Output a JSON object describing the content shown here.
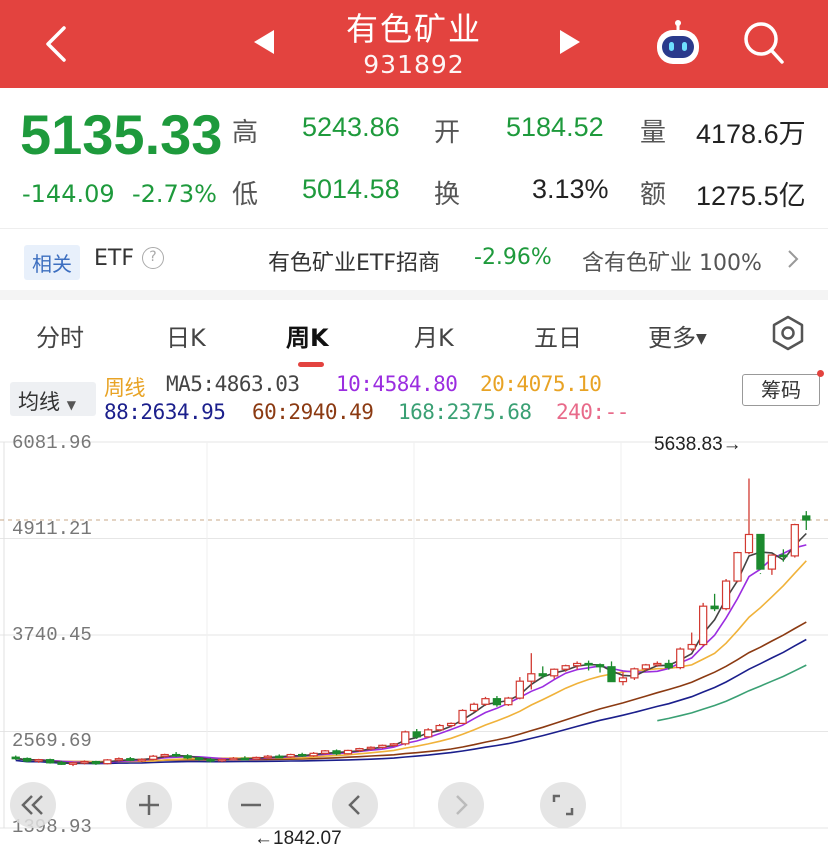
{
  "header": {
    "title": "有色矿业",
    "code": "931892"
  },
  "quote": {
    "price": "5135.33",
    "change": "-144.09",
    "change_pct": "-2.73%",
    "high_label": "高",
    "high": "5243.86",
    "low_label": "低",
    "low": "5014.58",
    "open_label": "开",
    "open": "5184.52",
    "turnover_label": "换",
    "turnover": "3.13%",
    "volume_label": "量",
    "volume": "4178.6万",
    "amount_label": "额",
    "amount": "1275.5亿"
  },
  "etf": {
    "tag": "相关",
    "label": "ETF",
    "name": "有色矿业ETF招商",
    "change_pct": "-2.96%",
    "holding": "含有色矿业 100%"
  },
  "tabs": [
    {
      "label": "分时"
    },
    {
      "label": "日K"
    },
    {
      "label": "周K"
    },
    {
      "label": "月K"
    },
    {
      "label": "五日"
    },
    {
      "label": "更多"
    }
  ],
  "indicators": {
    "selector": "均线",
    "period": "周线",
    "ma5": "MA5:4863.03",
    "ma10": "10:4584.80",
    "ma20": "20:4075.10",
    "ma88": "88:2634.95",
    "ma60": "60:2940.49",
    "ma168": "168:2375.68",
    "ma240": "240:--",
    "chip_button": "筹码"
  },
  "chart_data": {
    "type": "candlestick",
    "y_ticks": [
      "6081.96",
      "4911.21",
      "3740.45",
      "2569.69",
      "1398.93"
    ],
    "ylim": [
      1398.93,
      6081.96
    ],
    "max_label": "5638.83→",
    "min_label": "←1842.07",
    "last_price": 5135.33,
    "colors": {
      "up": "#d23a32",
      "down": "#1c8a2e",
      "ma5": "#444444",
      "ma10": "#9b2de0",
      "ma20": "#f0b23a",
      "ma60": "#8b3a12",
      "ma88": "#1b1f8c",
      "ma168": "#3aa074"
    },
    "candles": [
      [
        2258,
        2278,
        2225,
        2242
      ],
      [
        2242,
        2255,
        2195,
        2210
      ],
      [
        2210,
        2238,
        2190,
        2228
      ],
      [
        2228,
        2240,
        2180,
        2190
      ],
      [
        2190,
        2215,
        2165,
        2172
      ],
      [
        2172,
        2200,
        2150,
        2190
      ],
      [
        2190,
        2220,
        2170,
        2205
      ],
      [
        2205,
        2215,
        2165,
        2180
      ],
      [
        2180,
        2235,
        2170,
        2225
      ],
      [
        2225,
        2255,
        2205,
        2240
      ],
      [
        2240,
        2260,
        2210,
        2220
      ],
      [
        2220,
        2245,
        2200,
        2232
      ],
      [
        2232,
        2285,
        2220,
        2270
      ],
      [
        2270,
        2300,
        2255,
        2290
      ],
      [
        2290,
        2320,
        2260,
        2275
      ],
      [
        2275,
        2295,
        2235,
        2250
      ],
      [
        2250,
        2262,
        2215,
        2230
      ],
      [
        2230,
        2250,
        2195,
        2215
      ],
      [
        2215,
        2240,
        2200,
        2232
      ],
      [
        2232,
        2260,
        2218,
        2245
      ],
      [
        2245,
        2270,
        2228,
        2238
      ],
      [
        2238,
        2266,
        2225,
        2255
      ],
      [
        2255,
        2285,
        2240,
        2270
      ],
      [
        2270,
        2292,
        2252,
        2262
      ],
      [
        2262,
        2300,
        2250,
        2290
      ],
      [
        2290,
        2312,
        2262,
        2275
      ],
      [
        2275,
        2320,
        2262,
        2305
      ],
      [
        2305,
        2345,
        2290,
        2335
      ],
      [
        2335,
        2352,
        2282,
        2300
      ],
      [
        2300,
        2348,
        2292,
        2340
      ],
      [
        2340,
        2372,
        2322,
        2362
      ],
      [
        2362,
        2390,
        2340,
        2378
      ],
      [
        2378,
        2412,
        2362,
        2402
      ],
      [
        2402,
        2430,
        2385,
        2420
      ],
      [
        2420,
        2580,
        2400,
        2565
      ],
      [
        2565,
        2600,
        2480,
        2505
      ],
      [
        2505,
        2610,
        2495,
        2590
      ],
      [
        2590,
        2660,
        2575,
        2642
      ],
      [
        2642,
        2680,
        2620,
        2668
      ],
      [
        2668,
        2840,
        2660,
        2825
      ],
      [
        2825,
        2920,
        2805,
        2900
      ],
      [
        2900,
        2990,
        2880,
        2968
      ],
      [
        2968,
        3000,
        2870,
        2895
      ],
      [
        2895,
        2990,
        2880,
        2975
      ],
      [
        2975,
        3230,
        2960,
        3180
      ],
      [
        3180,
        3520,
        3080,
        3270
      ],
      [
        3270,
        3360,
        3215,
        3245
      ],
      [
        3245,
        3335,
        3210,
        3325
      ],
      [
        3325,
        3380,
        3295,
        3368
      ],
      [
        3368,
        3420,
        3320,
        3395
      ],
      [
        3395,
        3430,
        3310,
        3380
      ],
      [
        3380,
        3395,
        3285,
        3355
      ],
      [
        3355,
        3420,
        3240,
        3175
      ],
      [
        3175,
        3285,
        3130,
        3220
      ],
      [
        3220,
        3345,
        3195,
        3330
      ],
      [
        3330,
        3390,
        3305,
        3378
      ],
      [
        3378,
        3420,
        3355,
        3395
      ],
      [
        3395,
        3440,
        3320,
        3345
      ],
      [
        3345,
        3590,
        3325,
        3570
      ],
      [
        3570,
        3770,
        3550,
        3625
      ],
      [
        3625,
        4130,
        3600,
        4090
      ],
      [
        4090,
        4240,
        4030,
        4060
      ],
      [
        4060,
        4420,
        4040,
        4395
      ],
      [
        4395,
        4750,
        4380,
        4740
      ],
      [
        4740,
        5638.83,
        4720,
        4960
      ],
      [
        4960,
        4490,
        4480,
        4540
      ],
      [
        4540,
        4720,
        4470,
        4710
      ],
      [
        4710,
        4780,
        4630,
        4700
      ],
      [
        4700,
        5090,
        4680,
        5080
      ],
      [
        5184.52,
        5243.86,
        5014.58,
        5135.33
      ]
    ]
  }
}
